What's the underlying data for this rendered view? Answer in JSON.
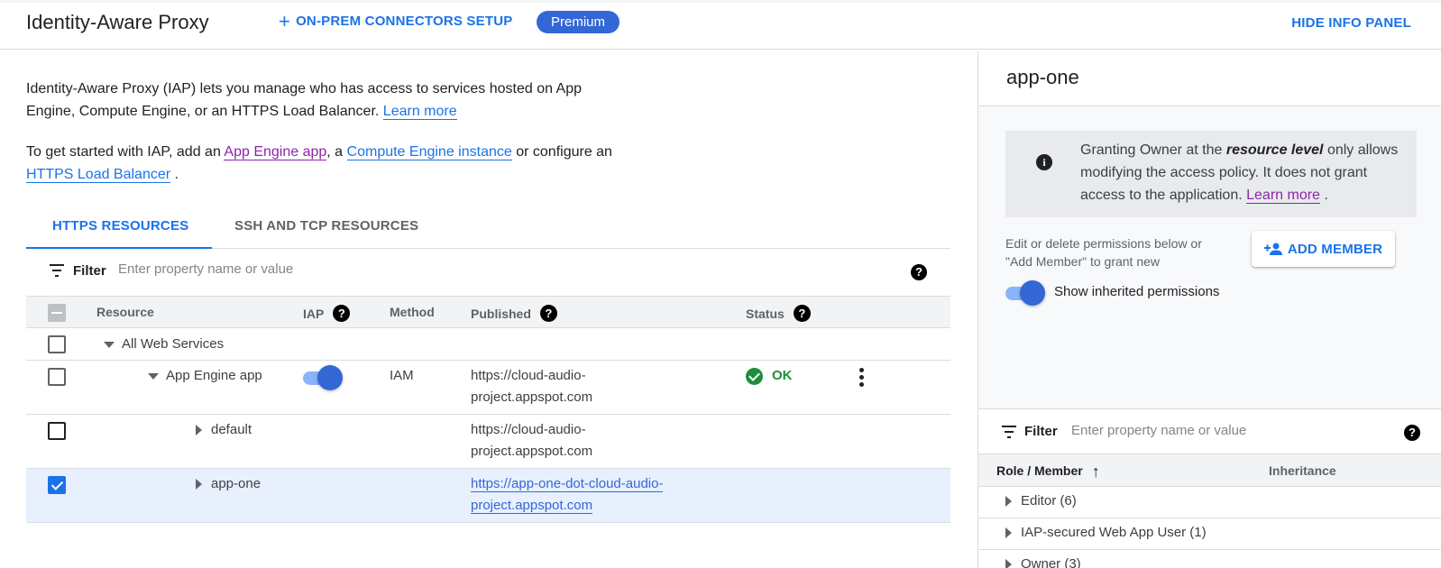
{
  "header": {
    "title": "Identity-Aware Proxy",
    "connectors_label": "ON-PREM CONNECTORS SETUP",
    "premium_badge": "Premium",
    "hide_panel_label": "HIDE INFO PANEL"
  },
  "intro": {
    "text1": "Identity-Aware Proxy (IAP) lets you manage who has access to services hosted on App Engine, Compute Engine, or an HTTPS Load Balancer.",
    "learn_more": "Learn more",
    "text2_start": "To get started with IAP, add an",
    "app_engine_link": "App Engine app",
    "text2_mid": ", a",
    "compute_link": "Compute Engine instance",
    "text2_mid2": "or configure an",
    "lb_link": "HTTPS Load Balancer",
    "text2_end": "."
  },
  "tabs": [
    {
      "label": "HTTPS RESOURCES",
      "active": true
    },
    {
      "label": "SSH AND TCP RESOURCES",
      "active": false
    }
  ],
  "filter": {
    "label": "Filter",
    "placeholder": "Enter property name or value"
  },
  "table": {
    "columns": {
      "resource": "Resource",
      "iap": "IAP",
      "method": "Method",
      "published": "Published",
      "status": "Status"
    },
    "rows": [
      {
        "resource": "All Web Services",
        "iap": null,
        "method": "",
        "published": "",
        "status": "",
        "checked": false
      },
      {
        "resource": "App Engine app",
        "iap": true,
        "method": "IAM",
        "published": "https://cloud-audio-project.appspot.com",
        "status": "OK",
        "checked": false
      },
      {
        "resource": "default",
        "iap": null,
        "method": "",
        "published": "https://cloud-audio-project.appspot.com",
        "status": "",
        "checked": false
      },
      {
        "resource": "app-one",
        "iap": null,
        "method": "",
        "published": "https://app-one-dot-cloud-audio-project.appspot.com",
        "status": "",
        "checked": true
      }
    ]
  },
  "info_panel": {
    "title": "app-one",
    "notice_start": "Granting Owner at the",
    "notice_em": "resource level",
    "notice_end": "only allows modifying the access policy. It does not grant access to the application.",
    "notice_link": "Learn more",
    "perm_text": "Edit or delete permissions below or \"Add Member\" to grant new",
    "add_member_label": "ADD MEMBER",
    "show_inherited_label": "Show inherited permissions",
    "show_inherited": true,
    "filter_label": "Filter",
    "filter_placeholder": "Enter property name or value",
    "col_role": "Role / Member",
    "col_inheritance": "Inheritance",
    "roles": [
      {
        "label": "Editor (6)"
      },
      {
        "label": "IAP-secured Web App User (1)"
      },
      {
        "label": "Owner (3)"
      }
    ]
  },
  "colors": {
    "accent": "#1a73e8",
    "premium": "#3367d6",
    "ok": "#1e8e3e",
    "visited_link": "#8e24aa"
  }
}
